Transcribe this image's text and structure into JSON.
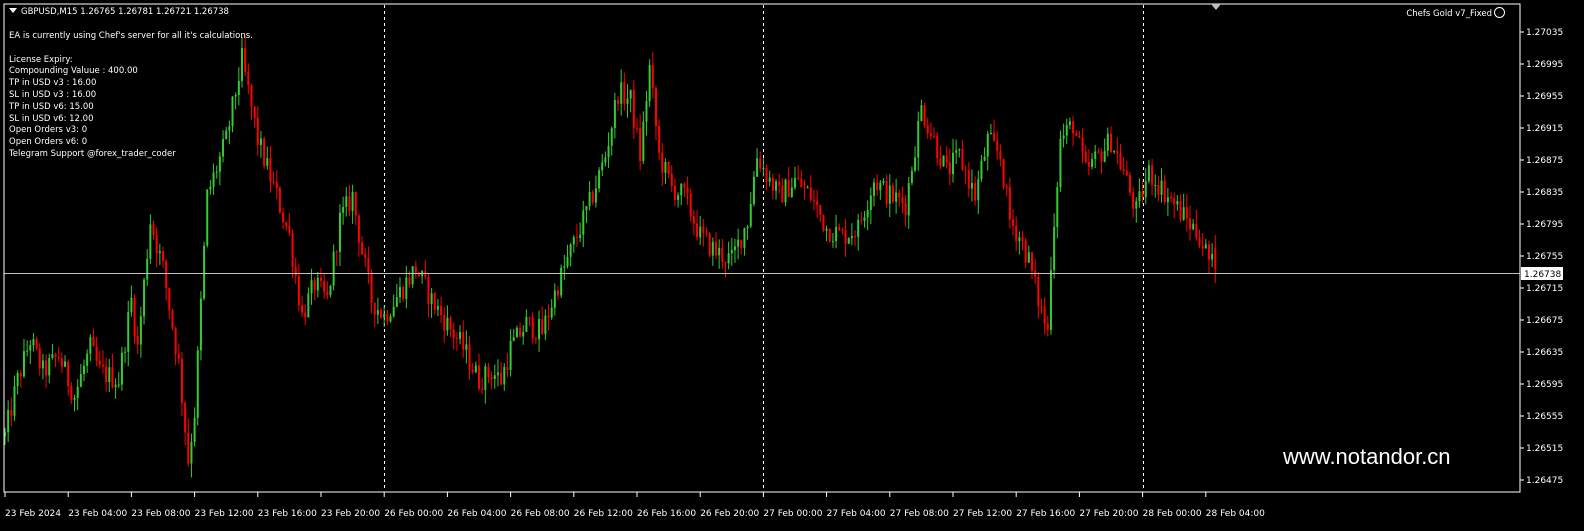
{
  "header": {
    "symbol_line": "GBPUSD,M15  1.26765 1.26781 1.26721 1.26738",
    "ea_name": "Chefs Gold v7_Fixed"
  },
  "info_lines": [
    "EA is currently using Chef's server for all it's calculations.",
    "",
    "License Expiry:",
    "Compounding Valuue : 400.00",
    "TP in USD v3 : 16.00",
    "SL in USD v3 : 16.00",
    "TP in USD v6: 15.00",
    "SL in USD v6: 12.00",
    "Open Orders v3: 0",
    "Open Orders v6: 0",
    "Telegram Support @forex_trader_coder"
  ],
  "watermark": "www.notandor.cn",
  "colors": {
    "background": "#000000",
    "bull": "#32cd32",
    "bear": "#ff0000",
    "grid": "#ffffff",
    "bid_line": "#c0c0c0",
    "text": "#ffffff"
  },
  "chart_data": {
    "type": "candlestick",
    "ylim": [
      1.26455,
      1.27055
    ],
    "price_ticks": [
      "1.27035",
      "1.26995",
      "1.26955",
      "1.26915",
      "1.26875",
      "1.26835",
      "1.26795",
      "1.26755",
      "1.26715",
      "1.26675",
      "1.26635",
      "1.26595",
      "1.26555",
      "1.26515",
      "1.26475"
    ],
    "current_price": "1.26738",
    "time_labels": [
      "23 Feb 2024",
      "23 Feb 04:00",
      "23 Feb 08:00",
      "23 Feb 12:00",
      "23 Feb 16:00",
      "23 Feb 20:00",
      "26 Feb 00:00",
      "26 Feb 04:00",
      "26 Feb 08:00",
      "26 Feb 12:00",
      "26 Feb 16:00",
      "26 Feb 20:00",
      "27 Feb 00:00",
      "27 Feb 04:00",
      "27 Feb 08:00",
      "27 Feb 12:00",
      "27 Feb 16:00",
      "27 Feb 20:00",
      "28 Feb 00:00",
      "28 Feb 04:00"
    ],
    "day_separators": [
      "26 Feb 00:00",
      "27 Feb 00:00",
      "28 Feb 00:00"
    ],
    "path": [
      [
        0,
        1.2653
      ],
      [
        4,
        1.266
      ],
      [
        8,
        1.2665
      ],
      [
        12,
        1.2661
      ],
      [
        17,
        1.2663
      ],
      [
        22,
        1.2658
      ],
      [
        27,
        1.2664
      ],
      [
        30,
        1.2661
      ],
      [
        36,
        1.266
      ],
      [
        40,
        1.267
      ],
      [
        42,
        1.2664
      ],
      [
        46,
        1.268
      ],
      [
        50,
        1.2674
      ],
      [
        55,
        1.2662
      ],
      [
        58,
        1.265
      ],
      [
        60,
        1.2656
      ],
      [
        64,
        1.2683
      ],
      [
        70,
        1.269
      ],
      [
        75,
        1.27
      ],
      [
        80,
        1.269
      ],
      [
        86,
        1.2683
      ],
      [
        90,
        1.2678
      ],
      [
        94,
        1.2668
      ],
      [
        98,
        1.2672
      ],
      [
        102,
        1.267
      ],
      [
        106,
        1.268
      ],
      [
        110,
        1.2683
      ],
      [
        113,
        1.2676
      ],
      [
        116,
        1.267
      ],
      [
        120,
        1.2668
      ],
      [
        125,
        1.2671
      ],
      [
        130,
        1.2674
      ],
      [
        135,
        1.267
      ],
      [
        140,
        1.2667
      ],
      [
        145,
        1.2664
      ],
      [
        150,
        1.266
      ],
      [
        154,
        1.2661
      ],
      [
        157,
        1.266
      ],
      [
        160,
        1.2664
      ],
      [
        165,
        1.2667
      ],
      [
        170,
        1.2666
      ],
      [
        175,
        1.2672
      ],
      [
        180,
        1.2677
      ],
      [
        185,
        1.2682
      ],
      [
        190,
        1.2688
      ],
      [
        194,
        1.2696
      ],
      [
        198,
        1.2695
      ],
      [
        201,
        1.2688
      ],
      [
        204,
        1.2699
      ],
      [
        207,
        1.2688
      ],
      [
        211,
        1.2684
      ],
      [
        215,
        1.2683
      ],
      [
        220,
        1.2678
      ],
      [
        225,
        1.2676
      ],
      [
        230,
        1.2675
      ],
      [
        235,
        1.268
      ],
      [
        238,
        1.2688
      ],
      [
        242,
        1.2685
      ],
      [
        245,
        1.2683
      ],
      [
        250,
        1.2685
      ],
      [
        255,
        1.2683
      ],
      [
        260,
        1.2679
      ],
      [
        265,
        1.2678
      ],
      [
        270,
        1.2679
      ],
      [
        275,
        1.2685
      ],
      [
        280,
        1.2683
      ],
      [
        285,
        1.2682
      ],
      [
        290,
        1.2694
      ],
      [
        294,
        1.269
      ],
      [
        298,
        1.2686
      ],
      [
        302,
        1.2688
      ],
      [
        307,
        1.2683
      ],
      [
        311,
        1.269
      ],
      [
        315,
        1.2688
      ],
      [
        318,
        1.268
      ],
      [
        321,
        1.2678
      ],
      [
        324,
        1.2675
      ],
      [
        327,
        1.267
      ],
      [
        330,
        1.2666
      ],
      [
        331,
        1.2675
      ],
      [
        334,
        1.269
      ],
      [
        338,
        1.2692
      ],
      [
        342,
        1.2686
      ],
      [
        346,
        1.2688
      ],
      [
        350,
        1.269
      ],
      [
        354,
        1.2686
      ],
      [
        358,
        1.2681
      ],
      [
        362,
        1.2686
      ],
      [
        366,
        1.2684
      ],
      [
        370,
        1.2682
      ],
      [
        374,
        1.268
      ],
      [
        378,
        1.2678
      ],
      [
        381,
        1.2675
      ],
      [
        383,
        1.26738
      ]
    ]
  }
}
